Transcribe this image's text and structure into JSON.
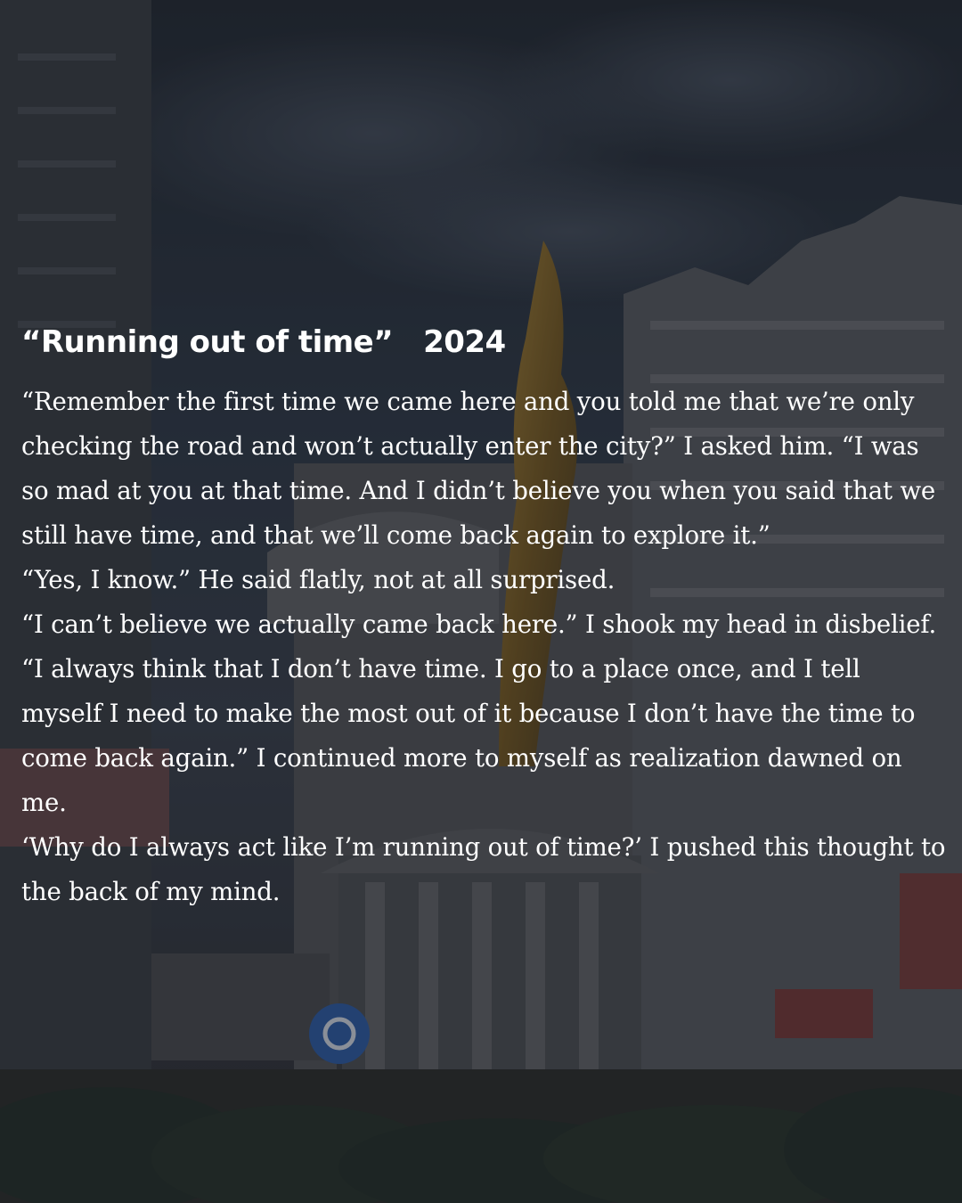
{
  "post": {
    "title": "“Running out of time”",
    "year": "2024",
    "paragraphs": [
      "“Remember the first time we came here and you told me that we’re only checking the road and won’t actually enter the city?” I asked him. “I was so mad at you at that time. And I didn’t believe you when you said that we still have time, and that we’ll come back again to explore it.”",
      "“Yes, I know.” He said flatly, not at all surprised.",
      "“I can’t believe we actually came back here.” I shook my head in disbelief. “I always think that I don’t have time. I go to a place once, and I tell myself I need to make the most out of it because I don’t have the time to come back again.” I continued more to myself as realization dawned on me.",
      "‘Why do I always act like I’m running out of time?’ I pushed this thought to the back of my mind."
    ]
  },
  "colors": {
    "text": "#ffffff",
    "overlay": "#16181c",
    "sky": "#2b3442",
    "sign": "#2d5fae",
    "statue": "#8a6a2a"
  }
}
